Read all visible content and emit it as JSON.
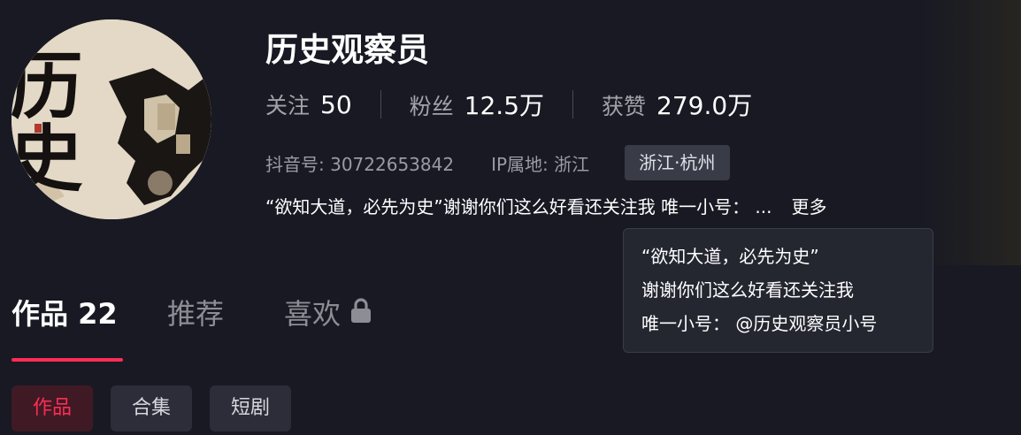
{
  "profile": {
    "name": "历史观察员",
    "stats": [
      {
        "label": "关注",
        "value": "50"
      },
      {
        "label": "粉丝",
        "value": "12.5万"
      },
      {
        "label": "获赞",
        "value": "279.0万"
      }
    ],
    "douyin_id": "抖音号: 30722653842",
    "ip_location": "IP属地: 浙江",
    "location_badge": "浙江·杭州",
    "bio_preview": "“欲知大道，必先为史”谢谢你们这么好看还关注我 唯一小号： ...",
    "bio_more": "更多",
    "avatar_text": "历史"
  },
  "tooltip": {
    "lines": [
      "“欲知大道，必先为史”",
      "谢谢你们这么好看还关注我",
      "唯一小号： @历史观察员小号"
    ]
  },
  "tabs": [
    {
      "label": "作品 22"
    },
    {
      "label": "推荐"
    },
    {
      "label": "喜欢"
    }
  ],
  "subtabs": [
    {
      "label": "作品"
    },
    {
      "label": "合集"
    },
    {
      "label": "短剧"
    }
  ],
  "icons": {
    "lock": "lock-icon"
  },
  "colors": {
    "accent": "#fe2c55",
    "background": "#181923"
  }
}
